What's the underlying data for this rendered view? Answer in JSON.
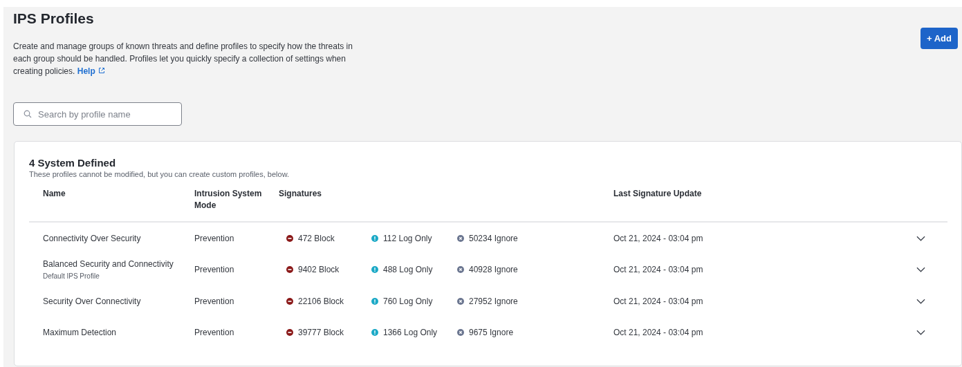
{
  "page": {
    "title": "IPS Profiles",
    "description": "Create and manage groups of known threats and define profiles to specify how the threats in each group should be handled. Profiles let you quickly specify a collection of settings when creating policies.",
    "help_link": "Help",
    "add_button": "+ Add"
  },
  "search": {
    "placeholder": "Search by profile name"
  },
  "section": {
    "title": "4 System Defined",
    "subtitle": "These profiles cannot be modified, but you can create custom profiles, below."
  },
  "table": {
    "columns": [
      "Name",
      "Intrusion System Mode",
      "Signatures",
      "Last Signature Update"
    ],
    "rows": [
      {
        "name": "Connectivity Over Security",
        "mode": "Prevention",
        "signatures": [
          {
            "kind": "block",
            "text": "472 Block"
          },
          {
            "kind": "log",
            "text": "112 Log Only"
          },
          {
            "kind": "ignore",
            "text": "50234 Ignore"
          }
        ],
        "updated": "Oct 21, 2024 - 03:04 pm",
        "expanded": false
      },
      {
        "name": "Balanced Security and Connectivity",
        "note": "Default IPS Profile",
        "mode": "Prevention",
        "signatures": [
          {
            "kind": "block",
            "text": "9402 Block"
          },
          {
            "kind": "log",
            "text": "488 Log Only"
          },
          {
            "kind": "ignore",
            "text": "40928 Ignore"
          }
        ],
        "updated": "Oct 21, 2024 - 03:04 pm",
        "expanded": false
      },
      {
        "name": "Security Over Connectivity",
        "mode": "Prevention",
        "signatures": [
          {
            "kind": "block",
            "text": "22106 Block"
          },
          {
            "kind": "log",
            "text": "760 Log Only"
          },
          {
            "kind": "ignore",
            "text": "27952 Ignore"
          }
        ],
        "updated": "Oct 21, 2024 - 03:04 pm",
        "expanded": false
      },
      {
        "name": "Maximum Detection",
        "mode": "Prevention",
        "signatures": [
          {
            "kind": "block",
            "text": "39777 Block"
          },
          {
            "kind": "log",
            "text": "1366 Log Only"
          },
          {
            "kind": "ignore",
            "text": "9675 Ignore"
          }
        ],
        "updated": "Oct 21, 2024 - 03:04 pm",
        "expanded": false
      }
    ]
  }
}
